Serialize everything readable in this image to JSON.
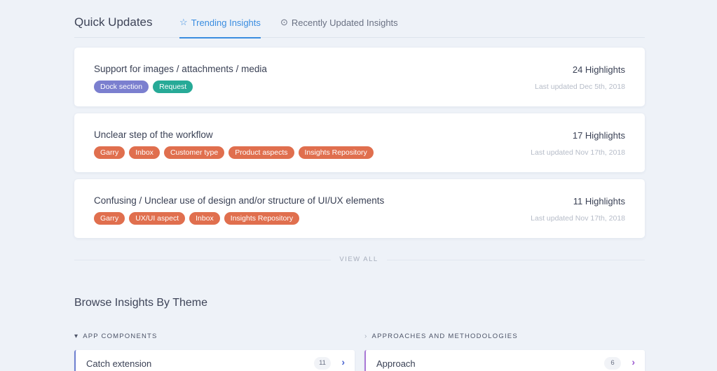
{
  "quick_updates": {
    "title": "Quick Updates",
    "tabs": [
      {
        "label": "Trending Insights",
        "icon": "star-icon",
        "active": true
      },
      {
        "label": "Recently Updated Insights",
        "icon": "clock-icon",
        "active": false
      }
    ]
  },
  "insights": [
    {
      "title": "Support for images / attachments / media",
      "tags": [
        {
          "label": "Dock section",
          "color": "#7b7fcf"
        },
        {
          "label": "Request",
          "color": "#27aa97"
        }
      ],
      "highlights": "24 Highlights",
      "updated": "Last updated Dec 5th, 2018"
    },
    {
      "title": "Unclear step of the workflow",
      "tags": [
        {
          "label": "Garry",
          "color": "#e06f4e"
        },
        {
          "label": "Inbox",
          "color": "#e06f4e"
        },
        {
          "label": "Customer type",
          "color": "#e06f4e"
        },
        {
          "label": "Product aspects",
          "color": "#e06f4e"
        },
        {
          "label": "Insights Repository",
          "color": "#e06f4e"
        }
      ],
      "highlights": "17 Highlights",
      "updated": "Last updated Nov 17th, 2018"
    },
    {
      "title": "Confusing / Unclear use of design and/or structure of UI/UX elements",
      "tags": [
        {
          "label": "Garry",
          "color": "#e06f4e"
        },
        {
          "label": "UX/UI aspect",
          "color": "#e06f4e"
        },
        {
          "label": "Inbox",
          "color": "#e06f4e"
        },
        {
          "label": "Insights Repository",
          "color": "#e06f4e"
        }
      ],
      "highlights": "11 Highlights",
      "updated": "Last updated Nov 17th, 2018"
    }
  ],
  "view_all_label": "VIEW ALL",
  "browse": {
    "title": "Browse Insights By Theme",
    "groups": [
      {
        "label": "APP COMPONENTS",
        "expanded": true,
        "items": [
          {
            "label": "Catch extension",
            "count": "11",
            "color": "#6d7fd0"
          }
        ]
      },
      {
        "label": "APPROACHES AND METHODOLOGIES",
        "expanded": false,
        "items": [
          {
            "label": "Approach",
            "count": "6",
            "color": "#a977d6"
          }
        ]
      }
    ]
  },
  "colors": {
    "accent": "#3a8de0",
    "background": "#eef2f8",
    "tag_purple": "#7b7fcf",
    "tag_teal": "#27aa97",
    "tag_orange": "#e06f4e"
  }
}
